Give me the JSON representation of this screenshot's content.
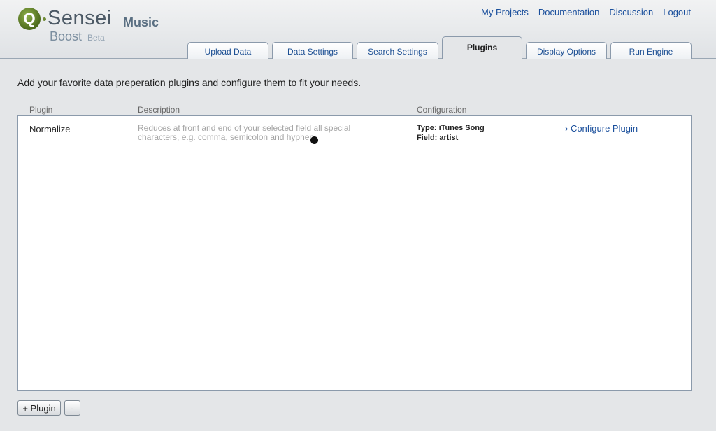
{
  "logo": {
    "q": "Q",
    "sensei": "Sensei",
    "boost": "Boost",
    "beta": "Beta"
  },
  "app_name": "Music",
  "top_nav": {
    "my_projects": "My Projects",
    "documentation": "Documentation",
    "discussion": "Discussion",
    "logout": "Logout"
  },
  "tabs": [
    {
      "label": "Upload Data"
    },
    {
      "label": "Data Settings"
    },
    {
      "label": "Search Settings"
    },
    {
      "label": "Plugins"
    },
    {
      "label": "Display Options"
    },
    {
      "label": "Run Engine"
    }
  ],
  "active_tab": "Plugins",
  "intro_text": "Add your favorite data preperation plugins and configure them to fit your needs.",
  "columns": {
    "plugin": "Plugin",
    "description": "Description",
    "configuration": "Configuration"
  },
  "plugins": [
    {
      "name": "Normalize",
      "description": "Reduces at front and end of your selected field all special characters, e.g. comma, semicolon and hyphen.",
      "config_type": "Type: iTunes Song",
      "config_field": "Field: artist",
      "action": "› Configure Plugin"
    }
  ],
  "buttons": {
    "add": "+ Plugin",
    "remove": "-"
  },
  "colors": {
    "link": "#1a4f9c",
    "logo_green": "#6f8a36",
    "border": "#8b9aab"
  }
}
